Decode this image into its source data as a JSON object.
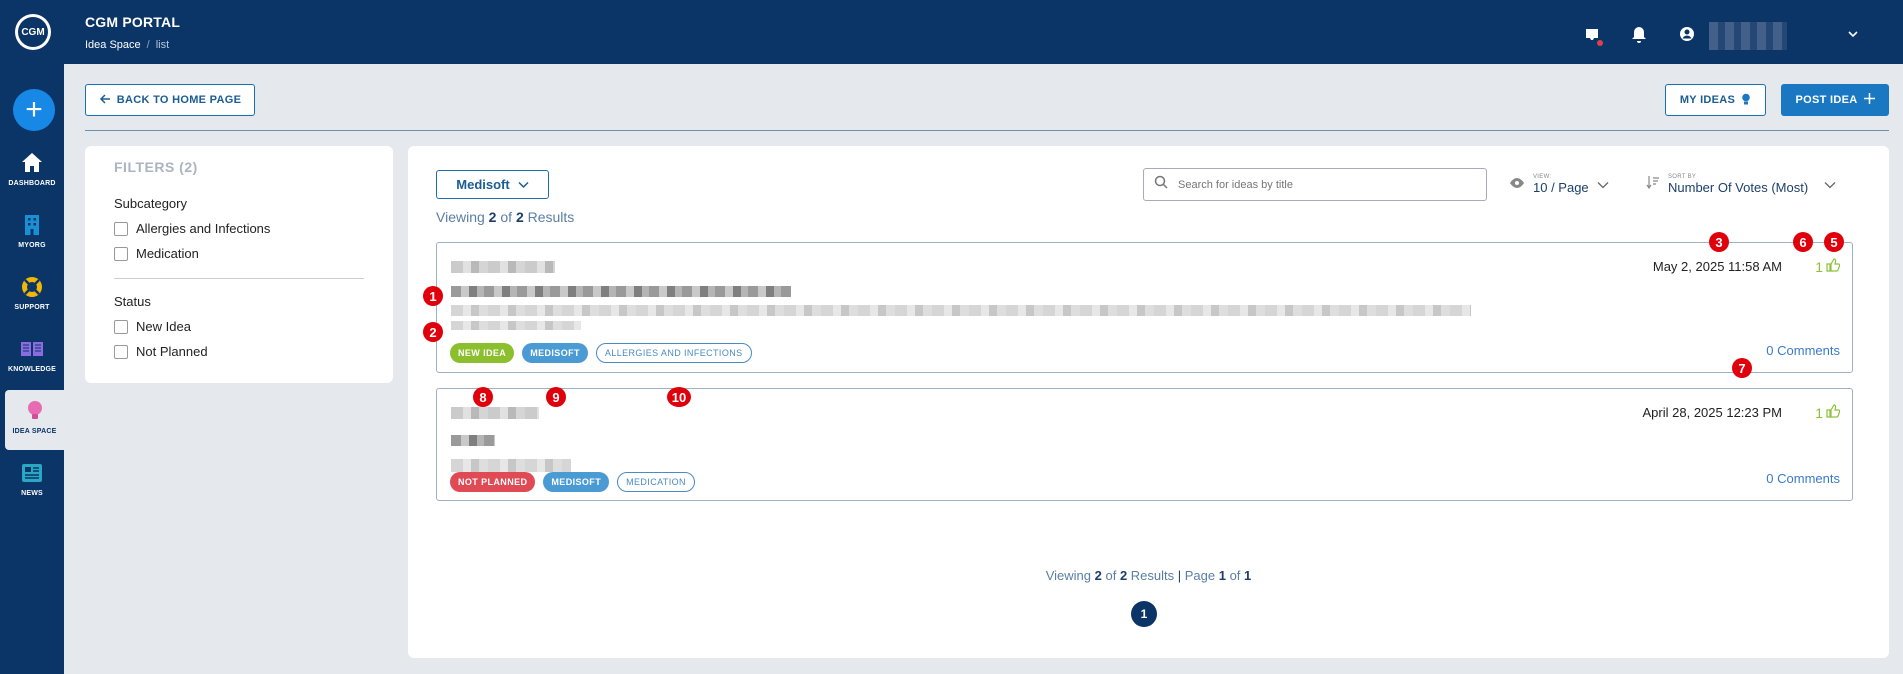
{
  "header": {
    "logo_text": "CGM",
    "title": "CGM PORTAL",
    "breadcrumb": {
      "section": "Idea Space",
      "sep": "/",
      "page": "list"
    }
  },
  "nav": {
    "items": [
      {
        "label": "DASHBOARD",
        "icon": "home-icon"
      },
      {
        "label": "MYORG",
        "icon": "building-icon"
      },
      {
        "label": "SUPPORT",
        "icon": "lifebuoy-icon"
      },
      {
        "label": "KNOWLEDGE",
        "icon": "book-icon"
      },
      {
        "label": "IDEA SPACE",
        "icon": "lightbulb-icon",
        "active": true
      },
      {
        "label": "NEWS",
        "icon": "newspaper-icon"
      }
    ]
  },
  "actions": {
    "back_label": "BACK TO HOME PAGE",
    "my_ideas_label": "MY IDEAS",
    "post_idea_label": "POST IDEA"
  },
  "filters": {
    "title": "FILTERS (2)",
    "subcategory_title": "Subcategory",
    "subcategories": [
      "Allergies and Infections",
      "Medication"
    ],
    "status_title": "Status",
    "statuses": [
      "New Idea",
      "Not Planned"
    ]
  },
  "toolbar": {
    "app_selected": "Medisoft",
    "viewing_prefix": "Viewing ",
    "viewing_count": "2",
    "viewing_mid": " of ",
    "viewing_total": "2",
    "viewing_suffix": " Results",
    "search_placeholder": "Search for ideas by title",
    "view_label": "VIEW:",
    "view_value": "10 / Page",
    "sort_label": "SORT BY",
    "sort_value": "Number Of Votes (Most)"
  },
  "ideas": [
    {
      "date": "May 2, 2025 11:58 AM",
      "votes": "1",
      "tags": [
        {
          "label": "NEW IDEA",
          "color": "#8cbf2e",
          "style": "solid"
        },
        {
          "label": "MEDISOFT",
          "color": "#4a9bd4",
          "style": "solid"
        },
        {
          "label": "ALLERGIES AND INFECTIONS",
          "color": "#4a8bc2",
          "style": "outline"
        }
      ],
      "comments": "0 Comments"
    },
    {
      "date": "April 28, 2025 12:23 PM",
      "votes": "1",
      "tags": [
        {
          "label": "NOT PLANNED",
          "color": "#e04a55",
          "style": "solid"
        },
        {
          "label": "MEDISOFT",
          "color": "#4a9bd4",
          "style": "solid"
        },
        {
          "label": "MEDICATION",
          "color": "#4a8bc2",
          "style": "outline"
        }
      ],
      "comments": "0 Comments"
    }
  ],
  "markers": [
    "1",
    "2",
    "3",
    "5",
    "6",
    "7",
    "8",
    "9",
    "10"
  ],
  "pager": {
    "prefix": "Viewing ",
    "count": "2",
    "mid": " of ",
    "total": "2",
    "results": " Results",
    "bar": " | ",
    "page_word": "Page ",
    "page": "1",
    "of": " of ",
    "pages": "1",
    "current": "1"
  }
}
